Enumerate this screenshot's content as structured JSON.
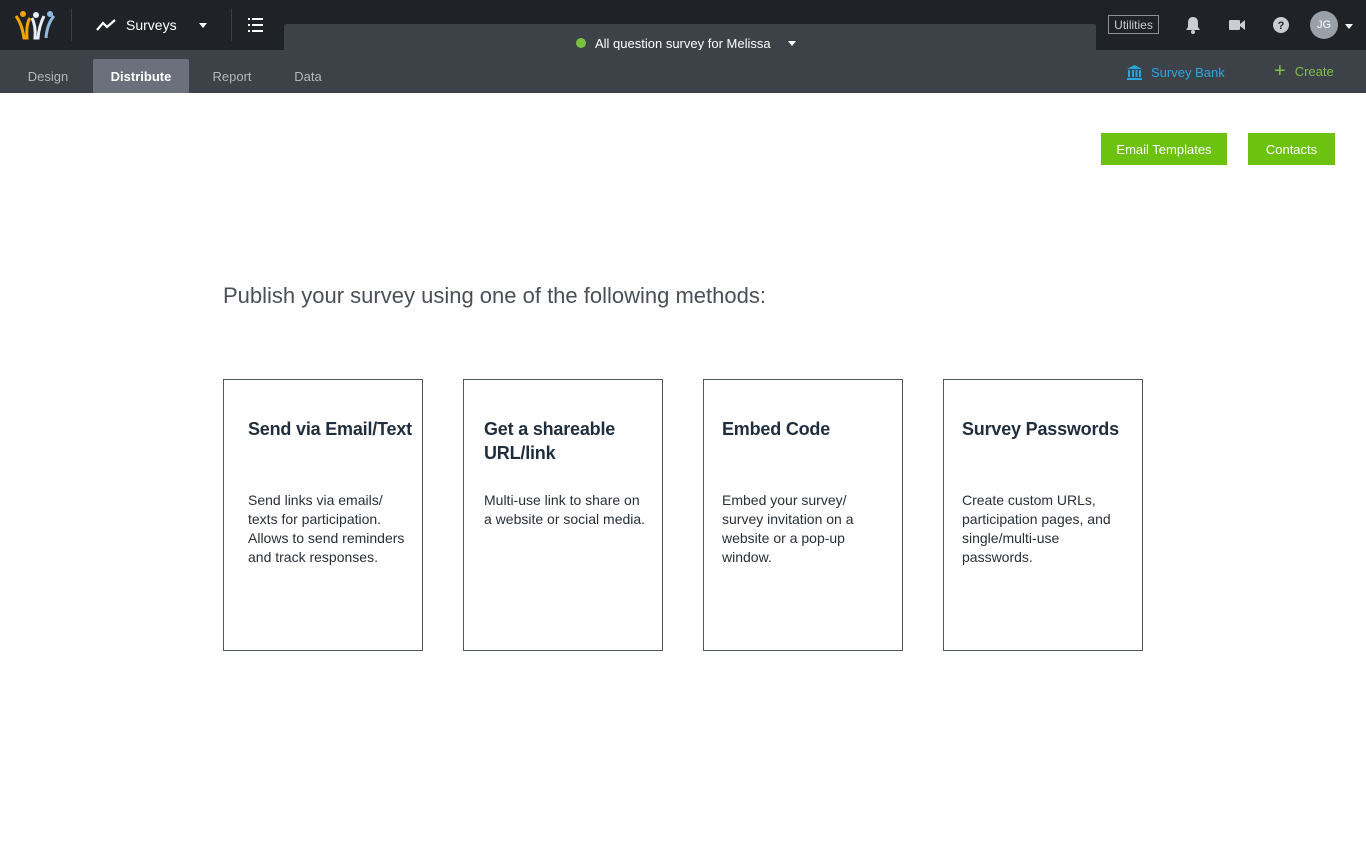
{
  "header": {
    "app_menu_label": "Surveys",
    "survey_title": "All question survey for Melissa",
    "utilities_label": "Utilities",
    "user_initials": "JG",
    "colors": {
      "topbar": "#1f2227",
      "status": "#7ac143"
    }
  },
  "nav": {
    "tabs": [
      {
        "label": "Design"
      },
      {
        "label": "Distribute",
        "active": true
      },
      {
        "label": "Report"
      },
      {
        "label": "Data"
      }
    ],
    "survey_bank_label": "Survey Bank",
    "create_label": "Create"
  },
  "actions": {
    "email_templates_label": "Email Templates",
    "contacts_label": "Contacts"
  },
  "main": {
    "heading": "Publish your survey using one of the following methods:",
    "cards": [
      {
        "title": "Send via Email/Text",
        "description": "Send links via emails/ texts for participation. Allows to send reminders and track responses."
      },
      {
        "title": "Get a shareable URL/link",
        "description": "Multi-use link to share on a website or social media."
      },
      {
        "title": "Embed Code",
        "description": "Embed your survey/ survey invitation on a website or a pop-up window."
      },
      {
        "title": "Survey Passwords",
        "description": "Create custom URLs, participation pages, and single/multi-use passwords."
      }
    ]
  },
  "icons": [
    "app-logo-icon",
    "trend-icon",
    "list-icon",
    "bell-icon",
    "video-icon",
    "help-icon",
    "bank-icon",
    "plus-icon"
  ]
}
